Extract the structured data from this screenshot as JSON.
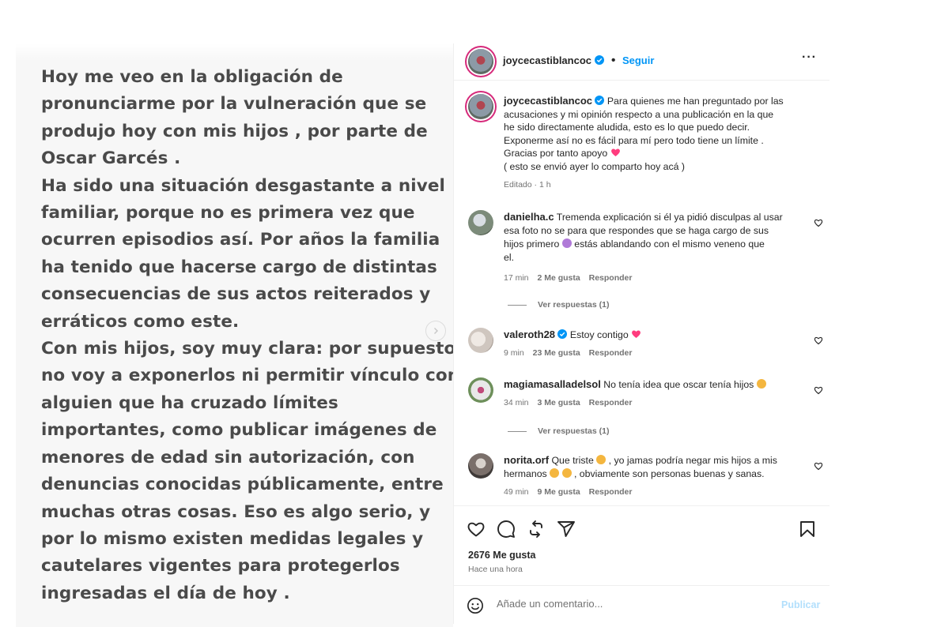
{
  "post_image": {
    "lines": [
      "Hoy me veo en la obligación de",
      "pronunciarme por la vulneración que se",
      "produjo hoy con mis hijos , por parte de",
      "Oscar Garcés .",
      "Ha sido una situación desgastante a nivel",
      "familiar, porque no es primera vez que",
      "ocurren episodios así. Por años  la familia",
      "ha tenido que hacerse cargo de distintas",
      "consecuencias de sus actos reiterados y",
      "erráticos como este.",
      "Con mis hijos, soy muy clara: por supuesto",
      "no voy a exponerlos ni permitir vínculo con",
      "alguien que ha cruzado límites",
      "importantes, como publicar imágenes de",
      "menores de edad sin autorización, con",
      "denuncias conocidas públicamente, entre",
      "muchas otras cosas. Eso es algo serio, y",
      "por lo mismo existen medidas legales y",
      "cautelares vigentes para protegerlos",
      "ingresadas el día de hoy ."
    ],
    "next_icon": "chevron-right-icon"
  },
  "header": {
    "username": "joycecastiblancoc",
    "separator": "•",
    "follow_label": "Seguir",
    "more_label": "···"
  },
  "caption": {
    "username": "joycecastiblancoc",
    "lines": [
      "Para quienes me han preguntado por las",
      "acusaciones y mi opinión respecto a una publicación en la que",
      "he sido directamente aludida, esto es lo que puedo decir.",
      "Exponerme así no es fácil para mí pero todo tiene un límite .",
      "Gracias por tanto apoyo",
      "( esto se envió ayer lo comparto hoy acá )"
    ],
    "meta": "Editado · 1 h"
  },
  "comments": [
    {
      "username": "danielha.c",
      "lines": [
        "Tremenda explicación si él ya pidió disculpas al usar",
        "esa foto no se para que respondes que se haga cargo de sus",
        "hijos primero",
        "estás ablandando con el mismo veneno que",
        "el."
      ],
      "time": "17 min",
      "likes": "2 Me gusta",
      "reply": "Responder",
      "view_replies": "Ver respuestas (1)"
    },
    {
      "username": "valeroth28",
      "text": "Estoy contigo",
      "time": "9 min",
      "likes": "23 Me gusta",
      "reply": "Responder"
    },
    {
      "username": "magiamasalladelsol",
      "text": "No tenía idea que oscar tenía hijos",
      "time": "34 min",
      "likes": "3 Me gusta",
      "reply": "Responder",
      "view_replies": "Ver respuestas (1)"
    },
    {
      "username": "norita.orf",
      "lines": [
        "Que triste",
        ", yo jamas podría negar mis hijos a mis",
        "hermanos",
        ", obviamente son personas buenas y sanas."
      ],
      "time": "49 min",
      "likes": "9 Me gusta",
      "reply": "Responder"
    }
  ],
  "actions": {
    "likes_count": "2676 Me gusta",
    "posted_time": "Hace una hora",
    "icons": [
      "heart-icon",
      "comment-icon",
      "repost-icon",
      "share-icon",
      "bookmark-icon"
    ]
  },
  "add_comment": {
    "placeholder": "Añade un comentario...",
    "publish_label": "Publicar"
  },
  "colors": {
    "accent": "#0095f6",
    "publish_disabled": "#b2dffc",
    "heart_emoji": "#ff3c7e",
    "story_ring": "#d6297a"
  }
}
